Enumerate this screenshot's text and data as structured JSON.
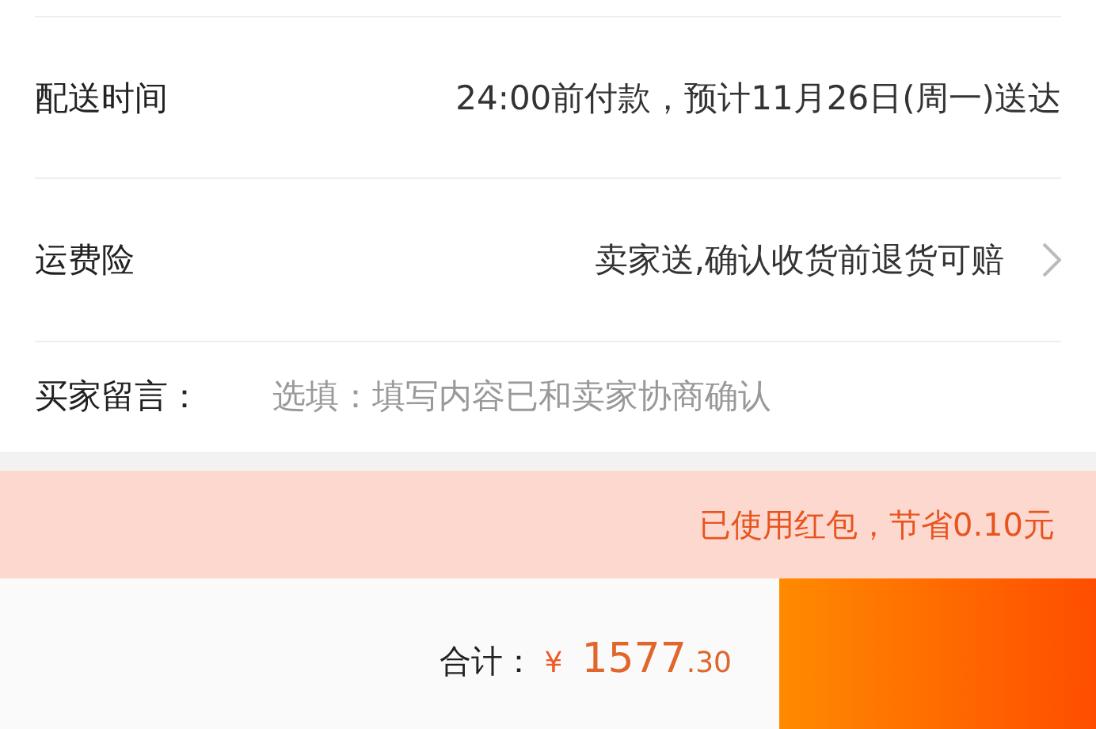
{
  "rows": [
    {
      "kind": "info",
      "label": "配送时间",
      "value": "24:00前付款，预计11月26日(周一)送达",
      "chevron": false
    },
    {
      "kind": "info",
      "label": "运费险",
      "value": "卖家送,确认收货前退货可赔",
      "chevron": true
    },
    {
      "kind": "input",
      "label": "买家留言：",
      "placeholder": "选填：填写内容已和卖家协商确认"
    }
  ],
  "notice": "已使用红包，节省0.10元",
  "footer": {
    "total_label": "合计：",
    "currency": "¥",
    "amount": "1577",
    "decimals": ".30"
  }
}
